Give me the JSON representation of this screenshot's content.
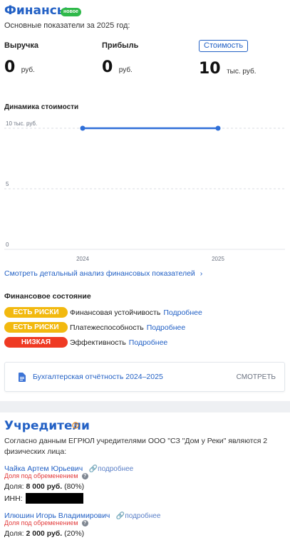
{
  "finance": {
    "title": "Финансы",
    "badge": "новое",
    "subtitle": "Основные показатели за 2025 год:",
    "metrics": [
      {
        "label": "Выручка",
        "value": "0",
        "unit": "руб."
      },
      {
        "label": "Прибыль",
        "value": "0",
        "unit": "руб."
      },
      {
        "label": "Стоимость",
        "value": "10",
        "unit": "тыс. руб."
      }
    ],
    "chart_title": "Динамика стоимости",
    "analysis_link": "Смотреть детальный анализ финансовых показателей",
    "state_title": "Финансовое состояние",
    "states": [
      {
        "pill": "ЕСТЬ РИСКИ",
        "color": "#f2b90f",
        "text": "Финансовая устойчивость",
        "link": "Подробнее"
      },
      {
        "pill": "ЕСТЬ РИСКИ",
        "color": "#f2b90f",
        "text": "Платежеспособность",
        "link": "Подробнее"
      },
      {
        "pill": "НИЗКАЯ",
        "color": "#ef3a23",
        "text": "Эффективность",
        "link": "Подробнее"
      }
    ],
    "report": {
      "title": "Бухгалтерская отчётность 2024–2025",
      "action": "СМОТРЕТЬ"
    }
  },
  "chart_data": {
    "type": "line",
    "x": [
      "2024",
      "2025"
    ],
    "series": [
      {
        "values": [
          10,
          10
        ]
      }
    ],
    "y_ticks": [
      "10 тыс. руб.",
      "5",
      "0"
    ],
    "x_ticks": [
      "2024",
      "2025"
    ],
    "ylim": [
      0,
      10
    ],
    "grid": true,
    "color": "#2f6fd8"
  },
  "founders": {
    "title": "Учредители",
    "description": "Согласно данным ЕГРЮЛ учредителями ООО \"СЗ \"Дом у Реки\" являются 2 физических лица:",
    "people": [
      {
        "name": "Чайка Артем Юрьевич",
        "more": "подробнее",
        "encumbrance": "Доля под обременением",
        "share_label": "Доля:",
        "share_amount": "8 000 руб.",
        "share_pct": "(80%)",
        "inn_label": "ИНН:"
      },
      {
        "name": "Илюшин Игорь Владимирович",
        "more": "подробнее",
        "encumbrance": "Доля под обременением",
        "share_label": "Доля:",
        "share_amount": "2 000 руб.",
        "share_pct": "(20%)"
      }
    ]
  }
}
